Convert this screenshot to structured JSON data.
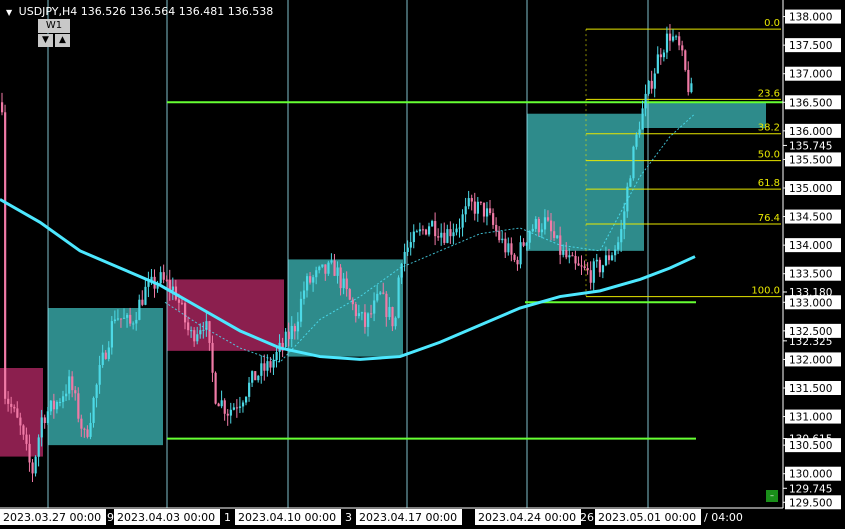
{
  "header": {
    "symbol": "USDJPY,H4",
    "ohlc": "136.526 136.564 136.481 136.538"
  },
  "timeframe": {
    "label": "W1",
    "down_icon": "triangle-down-icon",
    "up_icon": "triangle-up-icon"
  },
  "colors": {
    "background": "#000000",
    "bull_candle": "#4dd9e6",
    "bear_candle": "#f07aa6",
    "ma_line": "#4de8ff",
    "bull_box": "#2e8b8b",
    "bear_box": "#8b1f4e",
    "support_line": "#66ff33",
    "fib_level": "#e8e800",
    "vertical_line": "#9ff0ff"
  },
  "price_axis": {
    "labels": [
      "138.000",
      "137.500",
      "137.000",
      "136.500",
      "136.000",
      "135.745",
      "135.500",
      "135.000",
      "134.500",
      "134.000",
      "133.500",
      "133.180",
      "133.000",
      "132.500",
      "132.325",
      "132.000",
      "131.500",
      "131.000",
      "130.615",
      "130.500",
      "130.000",
      "129.745",
      "129.500"
    ],
    "highlight_labels": [
      "138.000",
      "137.500",
      "137.000",
      "136.500",
      "136.000",
      "135.500",
      "135.000",
      "134.500",
      "134.000",
      "133.500",
      "133.000",
      "132.500",
      "132.000",
      "131.500",
      "131.000",
      "130.500",
      "130.000",
      "129.500"
    ]
  },
  "fibonacci": {
    "levels": [
      "0.0",
      "23.6",
      "38.2",
      "50.0",
      "61.8",
      "76.4",
      "100.0"
    ]
  },
  "time_axis": {
    "labels": [
      "2023.03.27 00:00",
      "2023.04.03 00:00",
      "2023.04.10 00:00",
      "2023.04.17 00:00",
      "2023.04.24 00:00",
      "2023.05.01 00:00"
    ],
    "partial_labels": [
      "29",
      "1",
      "3",
      "26",
      "/ 04:00"
    ]
  },
  "chart_data": {
    "type": "candlestick",
    "symbol": "USDJPY",
    "timeframe": "H4",
    "ylim": [
      129.4,
      138.15
    ],
    "current_price": 136.538,
    "support_levels": [
      136.5,
      130.615,
      133.0
    ],
    "fib_prices": [
      137.78,
      136.55,
      135.95,
      135.48,
      134.98,
      134.37,
      133.1
    ]
  }
}
